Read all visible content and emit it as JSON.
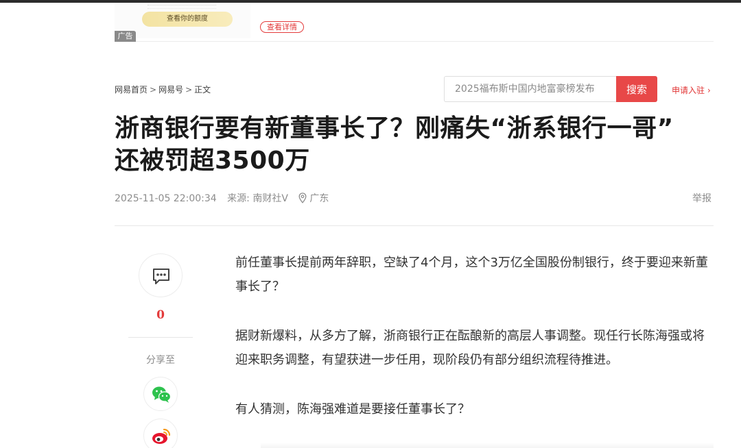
{
  "ad": {
    "quota_button": "查看你的额度",
    "detail_button": "查看详情",
    "tag": "广告"
  },
  "breadcrumb": {
    "items": [
      "网易首页",
      "网易号",
      "正文"
    ],
    "separator": ">"
  },
  "search": {
    "placeholder": "2025福布斯中国内地富豪榜发布",
    "button": "搜索"
  },
  "apply_link": "申请入驻",
  "article": {
    "title_line1": "浙商银行要有新董事长了？刚痛失“浙系银行一哥”",
    "title_line2": "还被罚超3500万",
    "datetime": "2025-11-05 22:00:34",
    "source": "来源: 南财社V",
    "location": "广东",
    "report": "举报",
    "paragraphs": [
      "前任董事长提前两年辞职，空缺了4个月，这个3万亿全国股份制银行，终于要迎来新董事长了？",
      "据财新爆料，从多方了解，浙商银行正在酝酿新的高层人事调整。现任行长陈海强或将迎来职务调整，有望获进一步任用，现阶段仍有部分组织流程待推进。",
      "有人猜测，陈海强难道是要接任董事长了？"
    ]
  },
  "sidebar": {
    "comment_count": "0",
    "share_label": "分享至",
    "share_targets": [
      "wechat-icon",
      "weibo-icon"
    ]
  },
  "colors": {
    "accent_red": "#e84848",
    "title": "#1b1b1b",
    "meta": "#8c8c8c"
  }
}
